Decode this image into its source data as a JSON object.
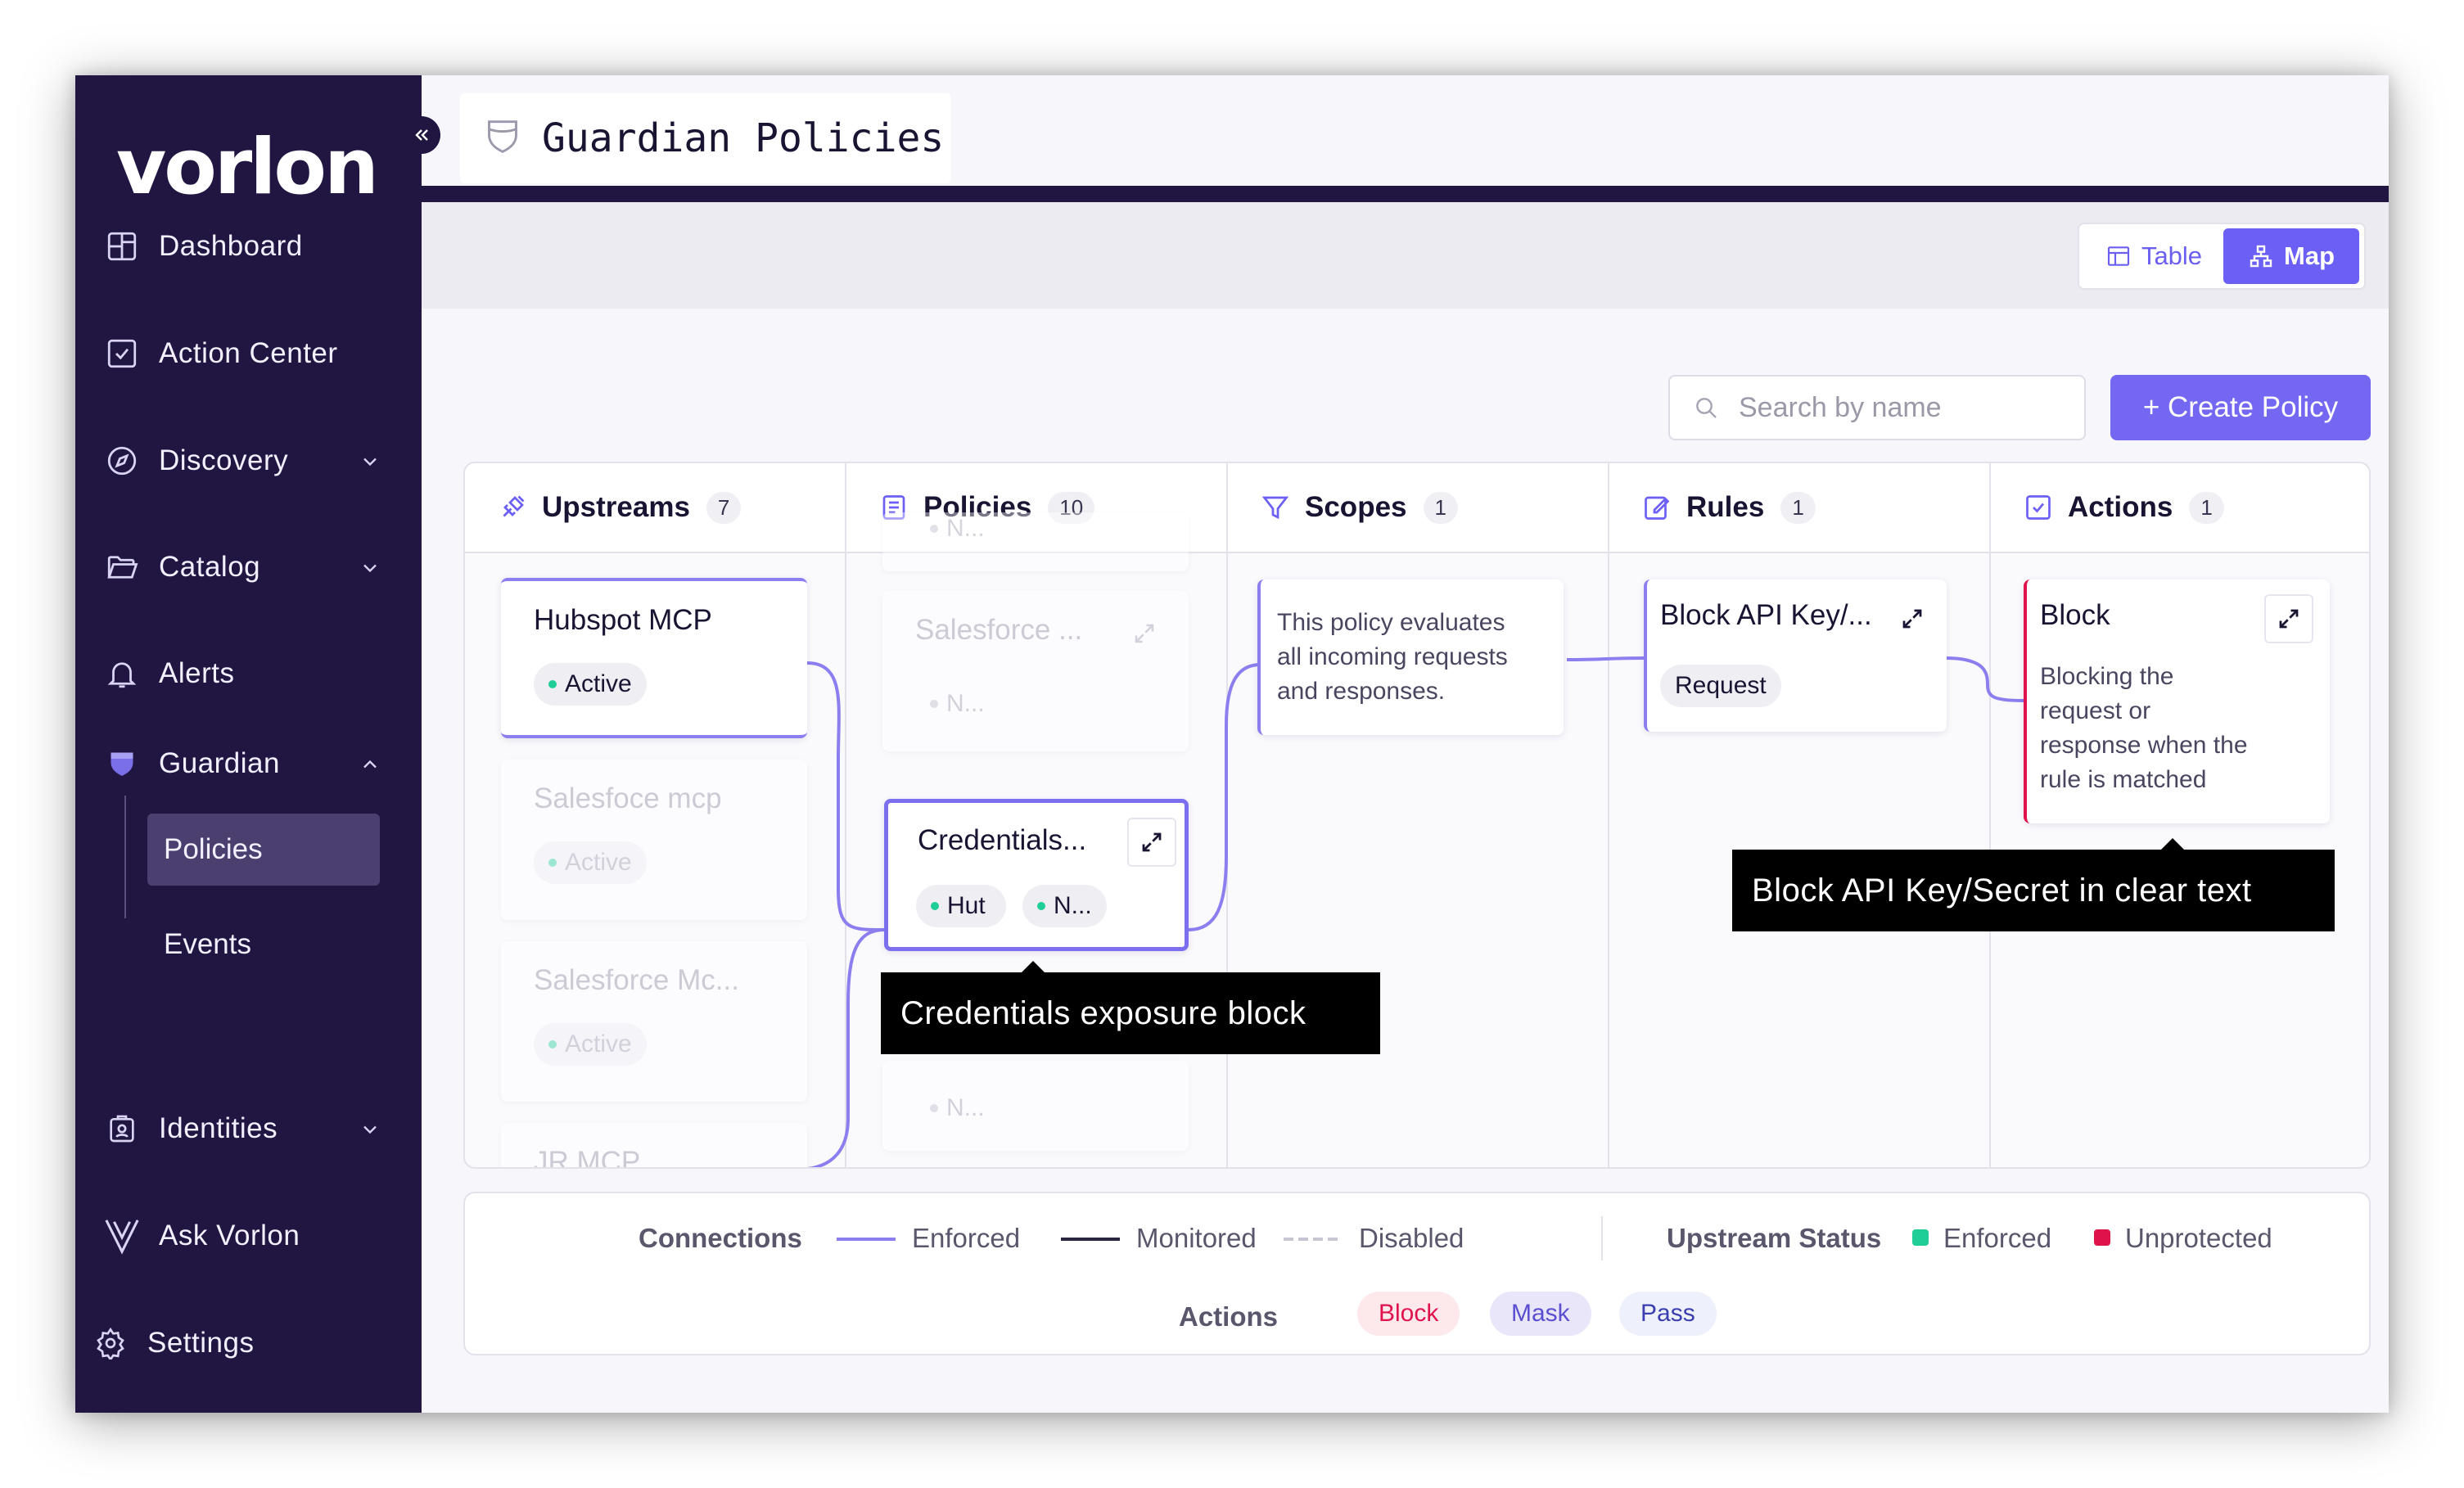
{
  "app": {
    "logo": "vorlon"
  },
  "sidebar": {
    "items": [
      {
        "label": "Dashboard",
        "icon": "dashboard-grid-icon"
      },
      {
        "label": "Action Center",
        "icon": "checkbox-icon"
      },
      {
        "label": "Discovery",
        "icon": "compass-icon"
      },
      {
        "label": "Catalog",
        "icon": "folder-icon"
      },
      {
        "label": "Alerts",
        "icon": "bell-icon"
      },
      {
        "label": "Guardian",
        "icon": "shield-icon"
      },
      {
        "label": "Identities",
        "icon": "id-badge-icon"
      },
      {
        "label": "Ask Vorlon",
        "icon": "vorlon-v-icon"
      },
      {
        "label": "Settings",
        "icon": "gear-icon"
      }
    ],
    "guardian_sub": [
      {
        "label": "Policies",
        "active": true
      },
      {
        "label": "Events",
        "active": false
      }
    ]
  },
  "header": {
    "title": "Guardian Policies",
    "icon": "shield-outline-icon"
  },
  "view_toggle": {
    "table_label": "Table",
    "map_label": "Map",
    "selected": "Map"
  },
  "search": {
    "placeholder": "Search by name",
    "value": ""
  },
  "create_button": {
    "label": "+ Create Policy"
  },
  "columns": [
    {
      "name": "Upstreams",
      "count": "7",
      "icon": "plug-icon"
    },
    {
      "name": "Policies",
      "count": "10",
      "icon": "document-icon"
    },
    {
      "name": "Scopes",
      "count": "1",
      "icon": "filter-icon"
    },
    {
      "name": "Rules",
      "count": "1",
      "icon": "edit-icon"
    },
    {
      "name": "Actions",
      "count": "1",
      "icon": "checkbox-icon"
    }
  ],
  "upstreams": [
    {
      "title": "Hubspot MCP",
      "status": "Active",
      "faded": false
    },
    {
      "title": "Salesfoce mcp",
      "status": "Active",
      "faded": true
    },
    {
      "title": "Salesforce Mc...",
      "status": "Active",
      "faded": true
    },
    {
      "title": "JR MCP",
      "status": "",
      "faded": true
    }
  ],
  "policies": [
    {
      "title": "",
      "tags": [
        "N..."
      ],
      "faded": true
    },
    {
      "title": "Salesforce ...",
      "tags": [
        "N..."
      ],
      "faded": true
    },
    {
      "title": "Credentials...",
      "tags": [
        "Hut",
        "N..."
      ],
      "faded": false,
      "selected": true
    },
    {
      "title": "",
      "tags": [
        "N..."
      ],
      "faded": true
    }
  ],
  "scope": {
    "description_lines": [
      "This policy evaluates",
      "all incoming requests",
      "and responses."
    ]
  },
  "rule": {
    "title": "Block API Key/...",
    "tag": "Request"
  },
  "action": {
    "title": "Block",
    "description_lines": [
      "Blocking the",
      "request or",
      "response when the",
      "rule is matched"
    ],
    "accent": "#e0124c"
  },
  "tooltips": {
    "policy": "Credentials exposure block",
    "rule": "Block API Key/Secret in clear text"
  },
  "legend": {
    "connections_label": "Connections",
    "enforced": "Enforced",
    "monitored": "Monitored",
    "disabled": "Disabled",
    "upstream_status_label": "Upstream Status",
    "status_enforced": "Enforced",
    "status_unprotected": "Unprotected",
    "actions_label": "Actions",
    "block": "Block",
    "mask": "Mask",
    "pass": "Pass"
  },
  "colors": {
    "sidebar_bg": "#211542",
    "accent": "#7468f3",
    "enforced_green": "#1fce97",
    "unprotected_red": "#e0124c",
    "connector": "#8b7ff0"
  }
}
